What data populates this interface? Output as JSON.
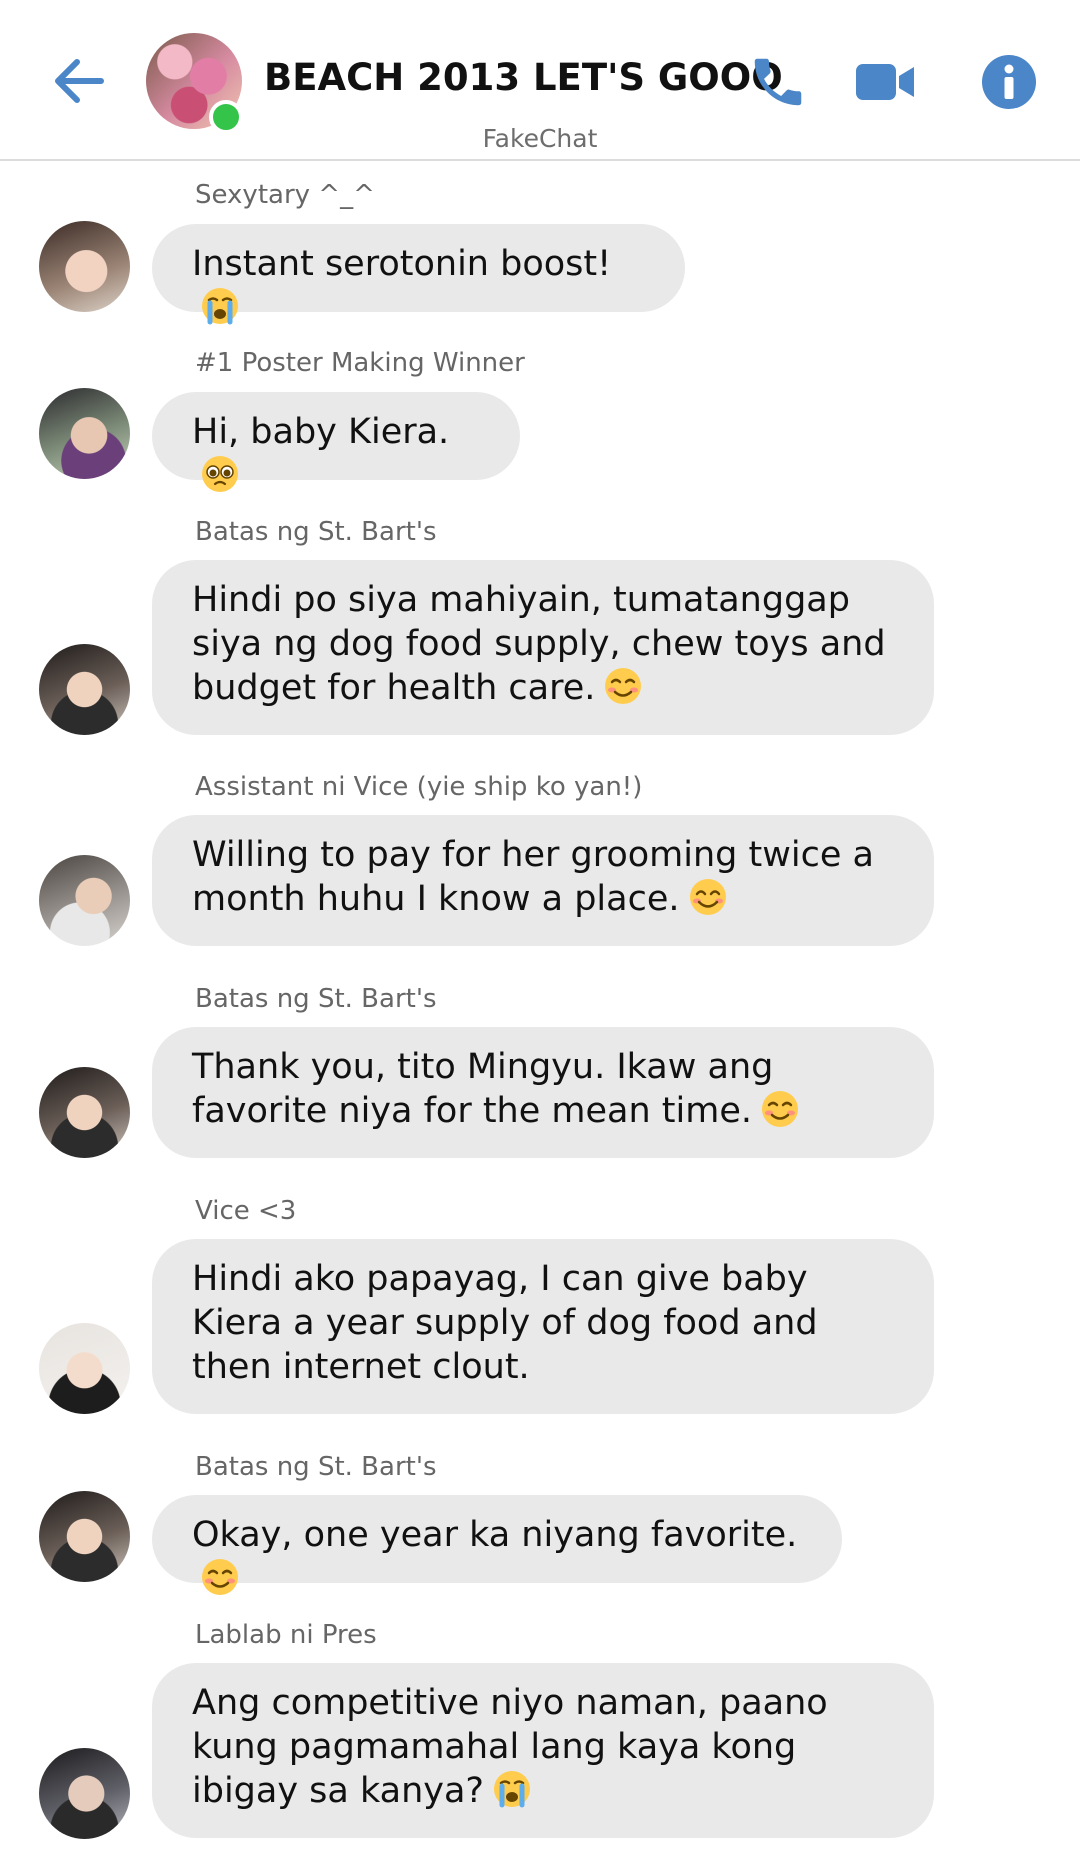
{
  "header": {
    "title": "BEACH 2013 LET'S GOOO",
    "app_name": "FakeChat",
    "back_icon": "arrow-left-icon",
    "call_icon": "phone-icon",
    "video_icon": "video-camera-icon",
    "info_icon": "info-icon",
    "online": true
  },
  "colors": {
    "accent": "#4a86c8",
    "bubble": "#e9e9e9",
    "online": "#35c44a",
    "sender_text": "#666666"
  },
  "messages": [
    {
      "sender": "Sexytary ^_^",
      "text": "Instant serotonin boost!",
      "emoji": "loudly-crying-face"
    },
    {
      "sender": "#1 Poster Making Winner",
      "text": "Hi, baby Kiera.",
      "emoji": "pleading-face"
    },
    {
      "sender": "Batas ng St. Bart's",
      "text": "Hindi po siya mahiyain, tumatanggap siya ng dog food supply, chew toys and budget for health care.",
      "emoji": "smiling-face"
    },
    {
      "sender": "Assistant ni Vice (yie ship ko yan!)",
      "text": "Willing to pay for her grooming twice a month huhu I know a place.",
      "emoji": "smiling-face-with-smiling-eyes"
    },
    {
      "sender": "Batas ng St. Bart's",
      "text": "Thank you, tito Mingyu. Ikaw ang favorite niya for the mean time.",
      "emoji": "smiling-face"
    },
    {
      "sender": "Vice <3",
      "text": "Hindi ako papayag, I can give baby Kiera a year supply of dog food and then internet clout.",
      "emoji": ""
    },
    {
      "sender": "Batas ng St. Bart's",
      "text": "Okay, one year ka niyang favorite.",
      "emoji": "smiling-face"
    },
    {
      "sender": "Lablab ni Pres",
      "text": "Ang competitive niyo naman, paano kung pagmamahal lang kaya kong ibigay sa kanya?",
      "emoji": "loudly-crying-face"
    }
  ]
}
